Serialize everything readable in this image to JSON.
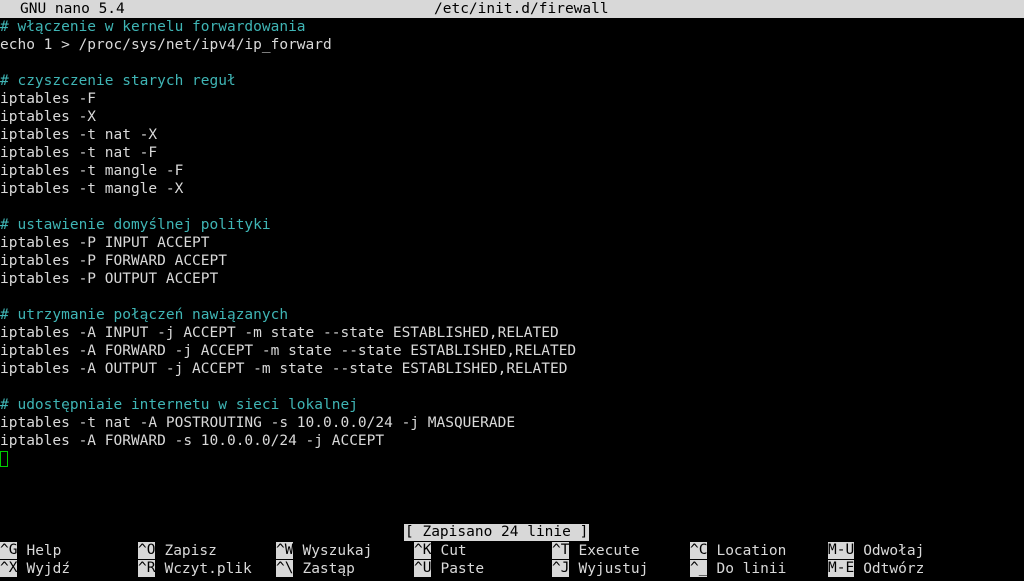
{
  "header": {
    "app": "GNU nano 5.4",
    "filename": "/etc/init.d/firewall"
  },
  "lines": [
    {
      "text": "# włączenie w kernelu forwardowania",
      "type": "comment"
    },
    {
      "text": "echo 1 > /proc/sys/net/ipv4/ip_forward",
      "type": "code"
    },
    {
      "text": "",
      "type": "code"
    },
    {
      "text": "# czyszczenie starych reguł",
      "type": "comment"
    },
    {
      "text": "iptables -F",
      "type": "code"
    },
    {
      "text": "iptables -X",
      "type": "code"
    },
    {
      "text": "iptables -t nat -X",
      "type": "code"
    },
    {
      "text": "iptables -t nat -F",
      "type": "code"
    },
    {
      "text": "iptables -t mangle -F",
      "type": "code"
    },
    {
      "text": "iptables -t mangle -X",
      "type": "code"
    },
    {
      "text": "",
      "type": "code"
    },
    {
      "text": "# ustawienie domyślnej polityki",
      "type": "comment"
    },
    {
      "text": "iptables -P INPUT ACCEPT",
      "type": "code"
    },
    {
      "text": "iptables -P FORWARD ACCEPT",
      "type": "code"
    },
    {
      "text": "iptables -P OUTPUT ACCEPT",
      "type": "code"
    },
    {
      "text": "",
      "type": "code"
    },
    {
      "text": "# utrzymanie połączeń nawiązanych",
      "type": "comment"
    },
    {
      "text": "iptables -A INPUT -j ACCEPT -m state --state ESTABLISHED,RELATED",
      "type": "code"
    },
    {
      "text": "iptables -A FORWARD -j ACCEPT -m state --state ESTABLISHED,RELATED",
      "type": "code"
    },
    {
      "text": "iptables -A OUTPUT -j ACCEPT -m state --state ESTABLISHED,RELATED",
      "type": "code"
    },
    {
      "text": "",
      "type": "code"
    },
    {
      "text": "# udostępniaie internetu w sieci lokalnej",
      "type": "comment"
    },
    {
      "text": "iptables -t nat -A POSTROUTING -s 10.0.0.0/24 -j MASQUERADE",
      "type": "code"
    },
    {
      "text": "iptables -A FORWARD -s 10.0.0.0/24 -j ACCEPT",
      "type": "code"
    }
  ],
  "status": "[ Zapisano 24 linie ]",
  "shortcuts": {
    "row1": [
      {
        "key": "^G",
        "label": "Help"
      },
      {
        "key": "^O",
        "label": "Zapisz"
      },
      {
        "key": "^W",
        "label": "Wyszukaj"
      },
      {
        "key": "^K",
        "label": "Cut"
      },
      {
        "key": "^T",
        "label": "Execute"
      },
      {
        "key": "^C",
        "label": "Location"
      },
      {
        "key": "M-U",
        "label": "Odwołaj"
      }
    ],
    "row2": [
      {
        "key": "^X",
        "label": "Wyjdź"
      },
      {
        "key": "^R",
        "label": "Wczyt.plik"
      },
      {
        "key": "^\\",
        "label": "Zastąp"
      },
      {
        "key": "^U",
        "label": "Paste"
      },
      {
        "key": "^J",
        "label": "Wyjustuj"
      },
      {
        "key": "^_",
        "label": "Do linii"
      },
      {
        "key": "M-E",
        "label": "Odtwórz"
      }
    ]
  }
}
